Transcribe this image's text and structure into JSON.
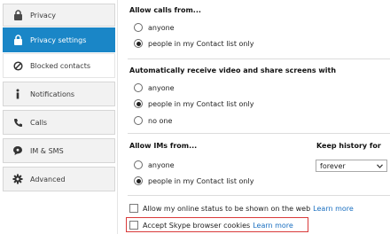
{
  "sidebar": {
    "items": [
      {
        "label": "Privacy",
        "icon": "lock-icon"
      },
      {
        "label": "Privacy settings",
        "icon": "lock-icon"
      },
      {
        "label": "Blocked contacts",
        "icon": "blocked-icon"
      },
      {
        "label": "Notifications",
        "icon": "info-icon"
      },
      {
        "label": "Calls",
        "icon": "phone-icon"
      },
      {
        "label": "IM & SMS",
        "icon": "chat-icon"
      },
      {
        "label": "Advanced",
        "icon": "gear-icon"
      }
    ],
    "active_index": 1,
    "accent_color": "#1a86c7"
  },
  "allow_calls": {
    "title": "Allow calls from...",
    "options": [
      "anyone",
      "people in my Contact list only"
    ],
    "selected": 1
  },
  "video_share": {
    "title": "Automatically receive video and share screens with",
    "options": [
      "anyone",
      "people in my Contact list only",
      "no one"
    ],
    "selected": 1
  },
  "allow_ims": {
    "title": "Allow IMs from...",
    "options": [
      "anyone",
      "people in my Contact list only"
    ],
    "selected": 1
  },
  "history": {
    "title": "Keep history for",
    "value": "forever"
  },
  "checkboxes": [
    {
      "label": "Allow my online status to be shown on the web",
      "link": "Learn more",
      "checked": false
    },
    {
      "label": "Accept Skype browser cookies",
      "link": "Learn more",
      "checked": false
    }
  ]
}
